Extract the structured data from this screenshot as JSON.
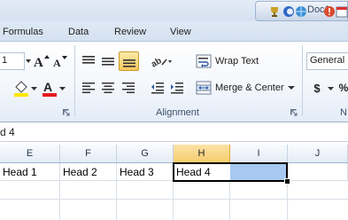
{
  "titlebar": {
    "doc_label": "Doc1"
  },
  "tabs": [
    {
      "label": "Formulas"
    },
    {
      "label": "Data"
    },
    {
      "label": "Review"
    },
    {
      "label": "View"
    }
  ],
  "ribbon": {
    "font": {
      "size_value": "1",
      "grow_icon": "font-grow-icon",
      "shrink_icon": "font-shrink-icon"
    },
    "alignment": {
      "wrap_text_label": "Wrap Text",
      "merge_center_label": "Merge & Center",
      "group_label": "Alignment"
    },
    "number": {
      "format_value": "General",
      "currency_symbol": "$",
      "percent_symbol": "%",
      "group_label_partial": "N"
    }
  },
  "formula_bar": {
    "value": "d 4"
  },
  "sheet": {
    "columns": [
      {
        "label": "E"
      },
      {
        "label": "F"
      },
      {
        "label": "G"
      },
      {
        "label": "H"
      },
      {
        "label": "I"
      },
      {
        "label": "J"
      }
    ],
    "selected_column": "H",
    "row": [
      {
        "value": "Head 1"
      },
      {
        "value": "Head 2"
      },
      {
        "value": "Head 3"
      },
      {
        "value": "Head 4"
      },
      {
        "value": ""
      },
      {
        "value": ""
      }
    ]
  },
  "colors": {
    "accent_selected_header": "#f7cd6e",
    "selection_fill": "#a7c8f0",
    "active_border": "#000000",
    "font_color_red": "#e51b1b",
    "highlight_yellow": "#ffe600"
  }
}
